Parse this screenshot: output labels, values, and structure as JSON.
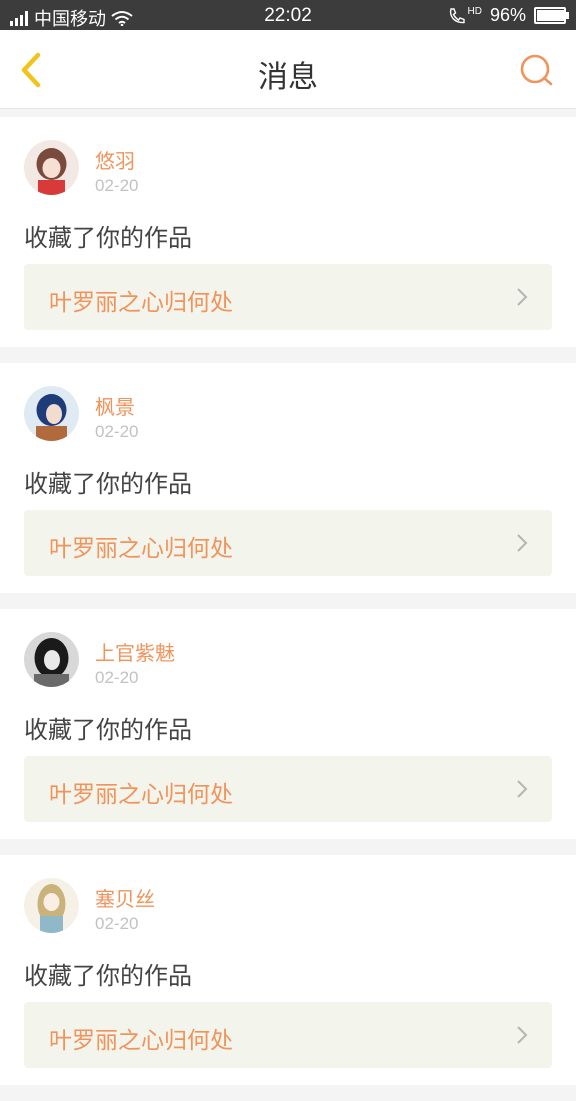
{
  "status_bar": {
    "carrier": "中国移动",
    "time": "22:02",
    "hd": "HD",
    "battery": "96%",
    "battery_level": 0.96,
    "icons": [
      "signal-icon",
      "wifi-icon",
      "hd-call-icon",
      "battery-icon"
    ]
  },
  "header": {
    "title": "消息",
    "back_icon": "chevron-left-icon",
    "search_icon": "search-icon"
  },
  "messages": [
    {
      "user": "悠羽",
      "date": "02-20",
      "action": "收藏了你的作品",
      "work": "叶罗丽之心归何处",
      "avatar_colors": [
        "#f3e9e4",
        "#7a4a3c",
        "#d83a3a"
      ]
    },
    {
      "user": "枫景",
      "date": "02-20",
      "action": "收藏了你的作品",
      "work": "叶罗丽之心归何处",
      "avatar_colors": [
        "#dfeaf3",
        "#1f3c7a",
        "#b06a3c"
      ]
    },
    {
      "user": "上官紫魅",
      "date": "02-20",
      "action": "收藏了你的作品",
      "work": "叶罗丽之心归何处",
      "avatar_colors": [
        "#d8d8d8",
        "#1a1a1a",
        "#6a6a6a"
      ]
    },
    {
      "user": "塞贝丝",
      "date": "02-20",
      "action": "收藏了你的作品",
      "work": "叶罗丽之心归何处",
      "avatar_colors": [
        "#f6f1e6",
        "#c9b37a",
        "#8fb8c8"
      ]
    }
  ],
  "colors": {
    "accent": "#f0945c",
    "back_icon": "#f0c419",
    "link_bg": "#f3f4ec",
    "status_bar": "#3c3c3c"
  }
}
